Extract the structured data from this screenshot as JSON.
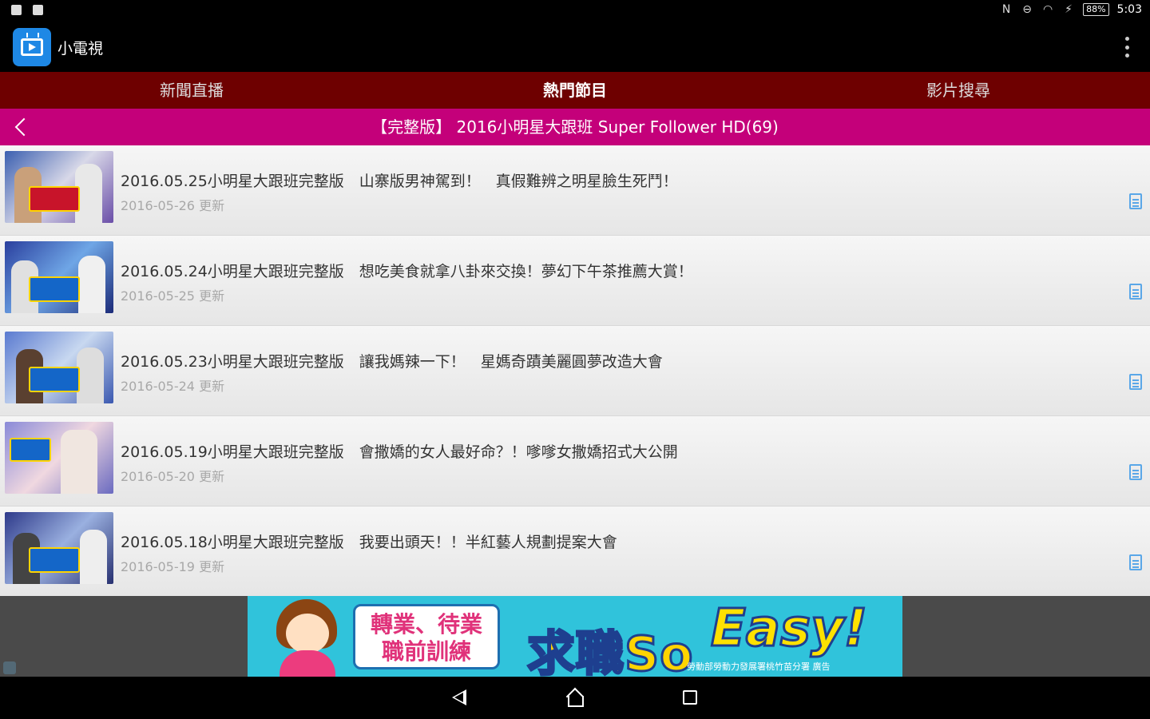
{
  "status_bar": {
    "time": "5:03",
    "battery": "88%"
  },
  "app_bar": {
    "title": "小電視",
    "app_icon": "tv-icon",
    "overflow_icon": "more-vert-icon"
  },
  "tabs": [
    {
      "label": "新聞直播",
      "active": false
    },
    {
      "label": "熱門節目",
      "active": true
    },
    {
      "label": "影片搜尋",
      "active": false
    }
  ],
  "title_bar": {
    "title": "【完整版】 2016小明星大跟班 Super Follower HD(69)",
    "back_icon": "chevron-left-icon"
  },
  "episodes": [
    {
      "title": "2016.05.25小明星大跟班完整版　山寨版男神駕到！　真假難辨之明星臉生死鬥！",
      "date": "2016-05-26 更新"
    },
    {
      "title": "2016.05.24小明星大跟班完整版　想吃美食就拿八卦來交換！夢幻下午茶推薦大賞！",
      "date": "2016-05-25 更新"
    },
    {
      "title": "2016.05.23小明星大跟班完整版　讓我媽辣一下！　星媽奇蹟美麗圓夢改造大會",
      "date": "2016-05-24 更新"
    },
    {
      "title": "2016.05.19小明星大跟班完整版　會撒嬌的女人最好命？！嗲嗲女撒嬌招式大公開",
      "date": "2016-05-20 更新"
    },
    {
      "title": "2016.05.18小明星大跟班完整版　我要出頭天！！半紅藝人規劃提案大會",
      "date": "2016-05-19 更新"
    }
  ],
  "ad": {
    "box_line1": "轉業、待業",
    "box_line2": "職前訓練",
    "slogan1": "求職So",
    "slogan2": "Easy!",
    "sponsor": "勞動部勞動力發展署桃竹苗分署 廣告"
  },
  "colors": {
    "tab_bar": "#6e0000",
    "title_bar": "#c4007a",
    "app_icon": "#1e88e5",
    "doc_icon": "#5aa7e8"
  }
}
